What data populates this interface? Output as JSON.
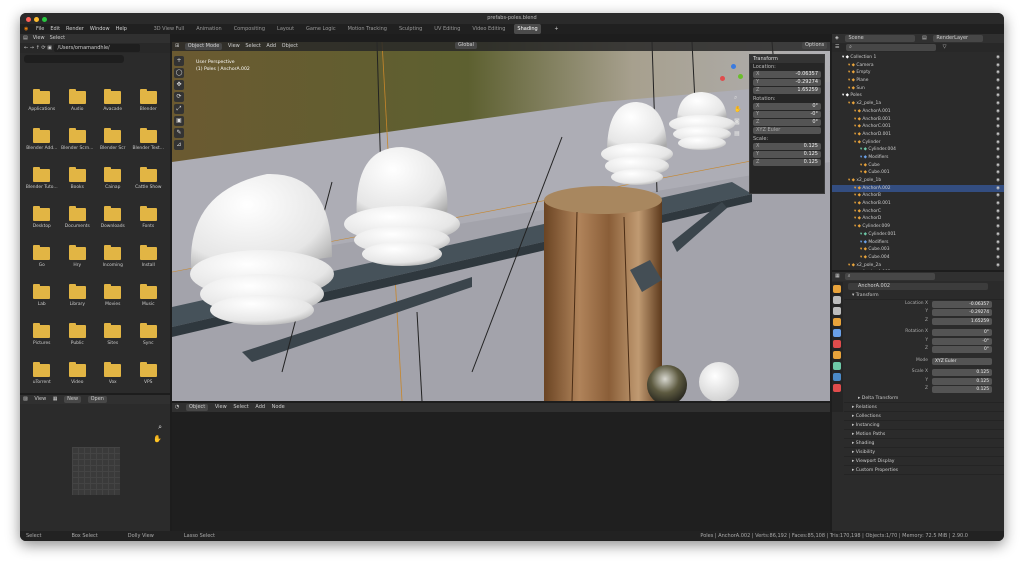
{
  "window": {
    "title": "prefabs-poles.blend",
    "traffic": [
      "#ff5f57",
      "#febc2e",
      "#28c840"
    ]
  },
  "menu": [
    "File",
    "Edit",
    "Render",
    "Window",
    "Help"
  ],
  "workspaces": [
    "3D View Full",
    "Animation",
    "Compositing",
    "Layout",
    "Game Logic",
    "Motion Tracking",
    "Sculpting",
    "UV Editing",
    "Video Editing",
    "Shading"
  ],
  "active_workspace": "Shading",
  "filebrowser": {
    "header": [
      "View",
      "Select"
    ],
    "path": "/Users/ornamandhle/",
    "items": [
      "Applications",
      "Audio",
      "Avacade",
      "Blender",
      "Blender Add...",
      "Blender Scrn...",
      "Blender Scr",
      "Blender Text...",
      "Blender Tuto...",
      "Books",
      "Cainap",
      "Cattle Show",
      "Desktop",
      "Documents",
      "Downloads",
      "Fonts",
      "Go",
      "Hry",
      "Incoming",
      "Install",
      "Lab",
      "Library",
      "Movies",
      "Music",
      "Pictures",
      "Public",
      "Sites",
      "Sync",
      "uTorrent",
      "Video",
      "Vox",
      "VPS"
    ]
  },
  "image_editor": {
    "header": [
      "View",
      "New",
      "Open"
    ]
  },
  "viewport": {
    "header": [
      "Object Mode",
      "View",
      "Select",
      "Add",
      "Object"
    ],
    "orientation": "Global",
    "options": "Options",
    "label1": "User Perspective",
    "label2": "(1) Poles | AnchorA.002",
    "tool_icons": [
      "+",
      "◯",
      "✥",
      "⟳",
      "⤢",
      "▣",
      "✎",
      "⊿"
    ],
    "npanel": {
      "title": "Transform",
      "location_label": "Location:",
      "location": [
        {
          "axis": "X",
          "value": "-0.06357"
        },
        {
          "axis": "Y",
          "value": "-0.29274"
        },
        {
          "axis": "Z",
          "value": "1.65259"
        }
      ],
      "rotation_label": "Rotation:",
      "rotation": [
        {
          "axis": "X",
          "value": "0°"
        },
        {
          "axis": "Y",
          "value": "-0°"
        },
        {
          "axis": "Z",
          "value": "0°"
        }
      ],
      "mode": "XYZ Euler",
      "scale_label": "Scale:",
      "scale": [
        {
          "axis": "X",
          "value": "0.125"
        },
        {
          "axis": "Y",
          "value": "0.125"
        },
        {
          "axis": "Z",
          "value": "0.125"
        }
      ]
    },
    "side_tabs": [
      "Item",
      "Tool",
      "View",
      "Edit",
      "Rest View"
    ]
  },
  "node_editor": {
    "header": [
      "Object",
      "View",
      "Select",
      "Add",
      "Node"
    ]
  },
  "outliner": {
    "scene": "Scene",
    "renderlayer": "RenderLayer",
    "rows": [
      {
        "name": "Collection 1",
        "indent": 1,
        "color": "#ffffff"
      },
      {
        "name": "Camera",
        "indent": 2,
        "color": "#e8a33b"
      },
      {
        "name": "Empty",
        "indent": 2,
        "color": "#e8a33b"
      },
      {
        "name": "Plane",
        "indent": 2,
        "color": "#e8a33b"
      },
      {
        "name": "Sun",
        "indent": 2,
        "color": "#e8a33b"
      },
      {
        "name": "Poles",
        "indent": 1,
        "color": "#ffffff"
      },
      {
        "name": "x2_pole_1a",
        "indent": 2,
        "color": "#e8a33b"
      },
      {
        "name": "AnchorA.001",
        "indent": 3,
        "color": "#e8a33b"
      },
      {
        "name": "AnchorB.001",
        "indent": 3,
        "color": "#e8a33b"
      },
      {
        "name": "AnchorC.001",
        "indent": 3,
        "color": "#e8a33b"
      },
      {
        "name": "AnchorD.001",
        "indent": 3,
        "color": "#e8a33b"
      },
      {
        "name": "Cylinder",
        "indent": 3,
        "color": "#e8a33b"
      },
      {
        "name": "Cylinder.004",
        "indent": 4,
        "color": "#6ec9a8"
      },
      {
        "name": "Modifiers",
        "indent": 4,
        "color": "#6aa0e8"
      },
      {
        "name": "Cube",
        "indent": 4,
        "color": "#e8a33b"
      },
      {
        "name": "Cube.001",
        "indent": 4,
        "color": "#e8a33b"
      },
      {
        "name": "x2_pole_1b",
        "indent": 2,
        "color": "#e8a33b"
      },
      {
        "name": "AnchorA.002",
        "indent": 3,
        "color": "#e8a33b",
        "selected": true
      },
      {
        "name": "AnchorB",
        "indent": 3,
        "color": "#e8a33b"
      },
      {
        "name": "AnchorB.001",
        "indent": 3,
        "color": "#e8a33b"
      },
      {
        "name": "AnchorC",
        "indent": 3,
        "color": "#e8a33b"
      },
      {
        "name": "AnchorD",
        "indent": 3,
        "color": "#e8a33b"
      },
      {
        "name": "Cylinder.009",
        "indent": 3,
        "color": "#e8a33b"
      },
      {
        "name": "Cylinder.001",
        "indent": 4,
        "color": "#6ec9a8"
      },
      {
        "name": "Modifiers",
        "indent": 4,
        "color": "#6aa0e8"
      },
      {
        "name": "Cube.003",
        "indent": 4,
        "color": "#e8a33b"
      },
      {
        "name": "Cube.004",
        "indent": 4,
        "color": "#e8a33b"
      },
      {
        "name": "x2_pole_2a",
        "indent": 2,
        "color": "#e8a33b"
      },
      {
        "name": "AnchorA.003",
        "indent": 3,
        "color": "#e8a33b"
      }
    ]
  },
  "properties": {
    "object_name": "AnchorA.002",
    "section": "Transform",
    "location": [
      {
        "label": "Location X",
        "value": "-0.06357"
      },
      {
        "label": "Y",
        "value": "-0.29274"
      },
      {
        "label": "Z",
        "value": "1.65259"
      }
    ],
    "rotation": [
      {
        "label": "Rotation X",
        "value": "0°"
      },
      {
        "label": "Y",
        "value": "-0°"
      },
      {
        "label": "Z",
        "value": "0°"
      }
    ],
    "mode_label": "Mode",
    "mode": "XYZ Euler",
    "scale": [
      {
        "label": "Scale X",
        "value": "0.125"
      },
      {
        "label": "Y",
        "value": "0.125"
      },
      {
        "label": "Z",
        "value": "0.125"
      }
    ],
    "delta": "Delta Transform",
    "sections": [
      "Relations",
      "Collections",
      "Instancing",
      "Motion Paths",
      "Shading",
      "Visibility",
      "Viewport Display",
      "Custom Properties"
    ]
  },
  "statusbar": {
    "left": [
      "Select",
      "Box Select",
      "Dolly View",
      "Lasso Select"
    ],
    "right": "Poles | AnchorA.002 | Verts:86,192 | Faces:85,108 | Tris:170,198 | Objects:1/70 | Memory: 72.5 MiB | 2.90.0"
  }
}
